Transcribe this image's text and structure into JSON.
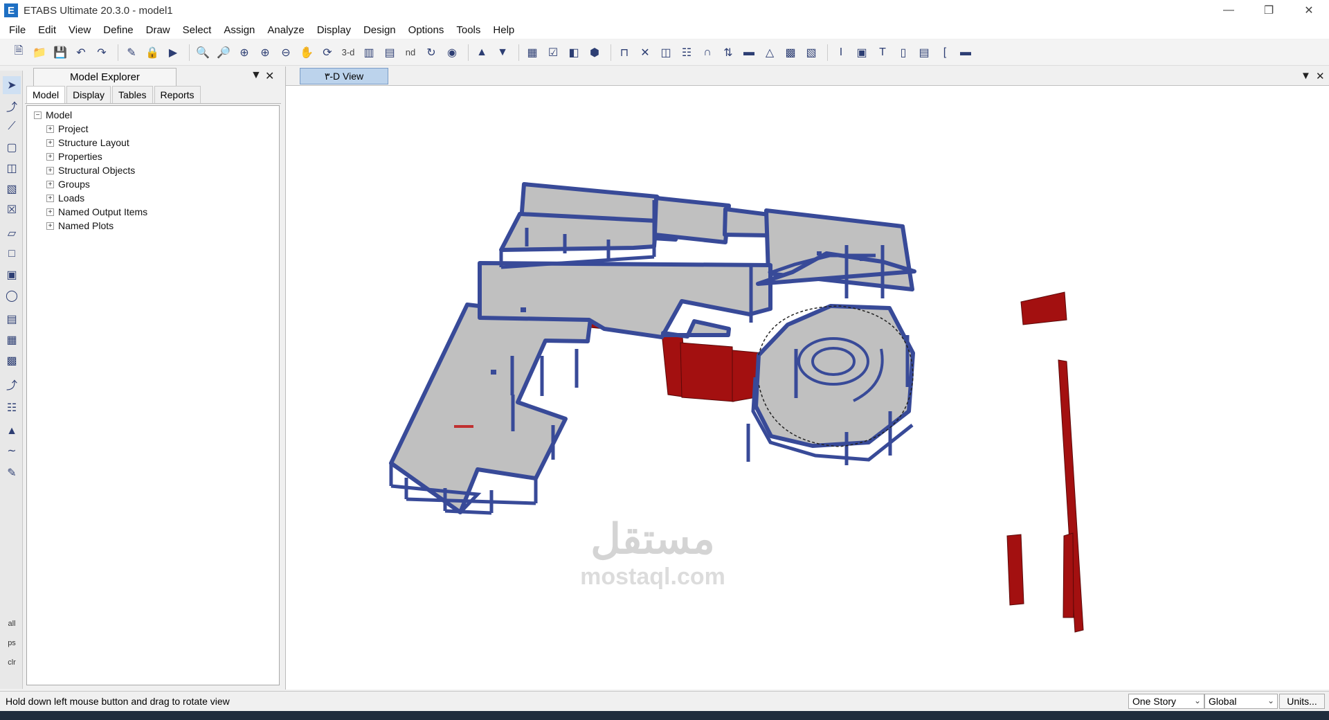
{
  "window": {
    "logo": "E",
    "title": "ETABS Ultimate 20.3.0 - model1"
  },
  "menu": [
    "File",
    "Edit",
    "View",
    "Define",
    "Draw",
    "Select",
    "Assign",
    "Analyze",
    "Display",
    "Design",
    "Options",
    "Tools",
    "Help"
  ],
  "toolbar": {
    "view_3d_label": "3-d",
    "nd_label": "nd"
  },
  "left_tools": {
    "all_label": "all",
    "ps_label": "ps",
    "clr_label": "clr"
  },
  "explorer": {
    "title": "Model Explorer",
    "tabs": [
      "Model",
      "Display",
      "Tables",
      "Reports"
    ],
    "active_tab": "Model",
    "tree_root": "Model",
    "tree_items": [
      "Project",
      "Structure Layout",
      "Properties",
      "Structural Objects",
      "Groups",
      "Loads",
      "Named Output Items",
      "Named Plots"
    ]
  },
  "view": {
    "tab_label": "٣-D View"
  },
  "status": {
    "message": "Hold down left mouse button and drag to rotate view",
    "story_selector": "One Story",
    "coord_selector": "Global",
    "units_button": "Units..."
  },
  "watermark": {
    "arabic": "مستقل",
    "latin": "mostaql.com"
  },
  "colors": {
    "slab": "#c0c0c0",
    "beam": "#4f5fa8",
    "wall": "#b01212",
    "view_tab": "#bcd3ec"
  },
  "icons": [
    "new-file-icon",
    "open-icon",
    "save-icon",
    "undo-icon",
    "redo-icon",
    "pencil-icon",
    "lock-icon",
    "run-icon",
    "zoom-window-icon",
    "zoom-rubber-icon",
    "zoom-extents-icon",
    "zoom-in-icon",
    "zoom-out-icon",
    "pan-icon",
    "rotate-icon",
    "view-xy-icon",
    "view-xz-icon",
    "refresh-icon",
    "perspective-icon",
    "move-up-icon",
    "move-down-icon"
  ]
}
